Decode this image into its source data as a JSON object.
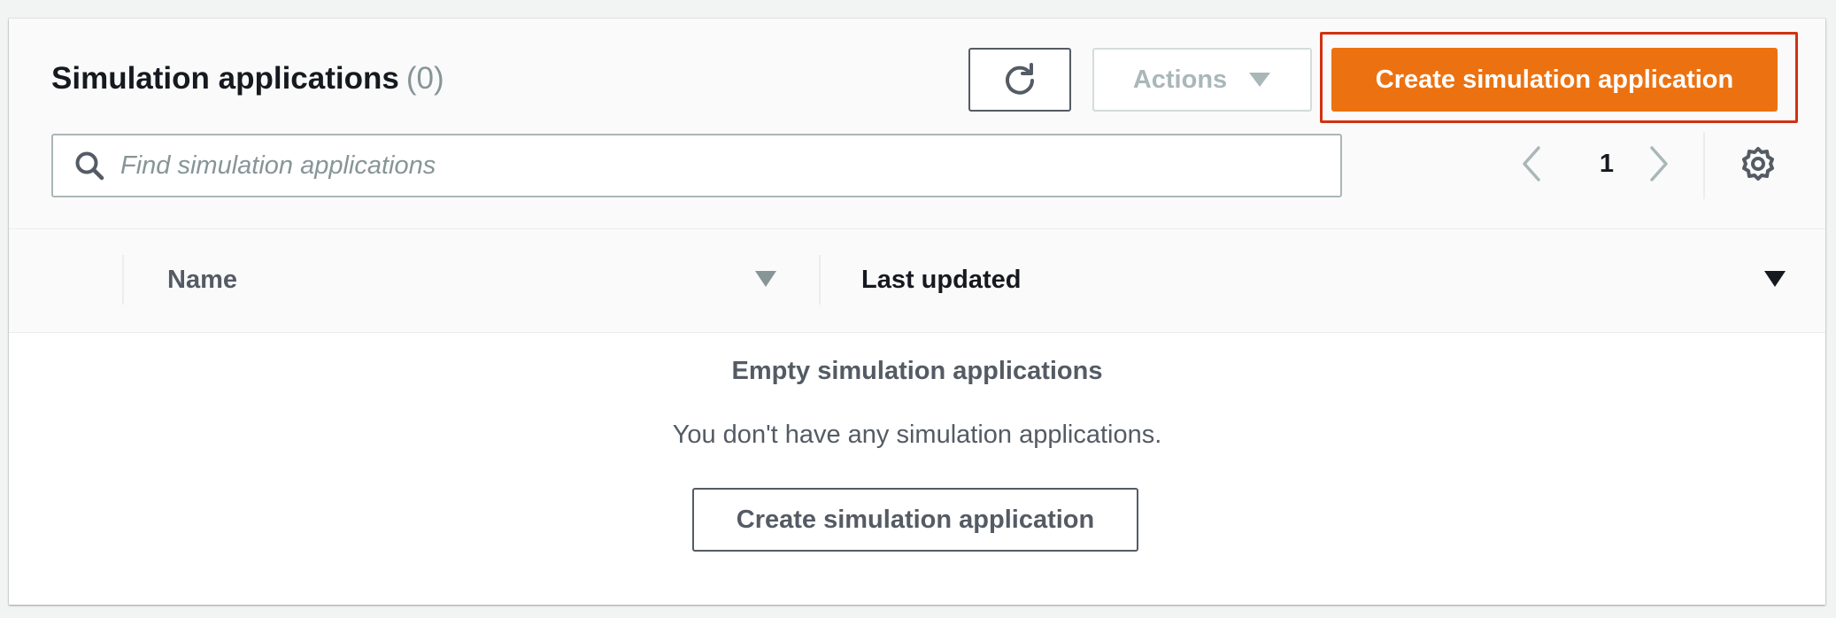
{
  "header": {
    "title": "Simulation applications",
    "count": "(0)"
  },
  "toolbar": {
    "refresh_icon": "refresh-icon",
    "actions_label": "Actions",
    "create_label": "Create simulation application"
  },
  "search": {
    "placeholder": "Find simulation applications"
  },
  "pagination": {
    "current_page": "1"
  },
  "table": {
    "columns": [
      {
        "label": "Name"
      },
      {
        "label": "Last updated"
      }
    ],
    "rows": []
  },
  "empty_state": {
    "title": "Empty simulation applications",
    "description": "You don't have any simulation applications.",
    "button_label": "Create simulation application"
  },
  "colors": {
    "primary": "#ec7211",
    "highlight": "#d13212",
    "text": "#16191f",
    "muted": "#879596"
  }
}
